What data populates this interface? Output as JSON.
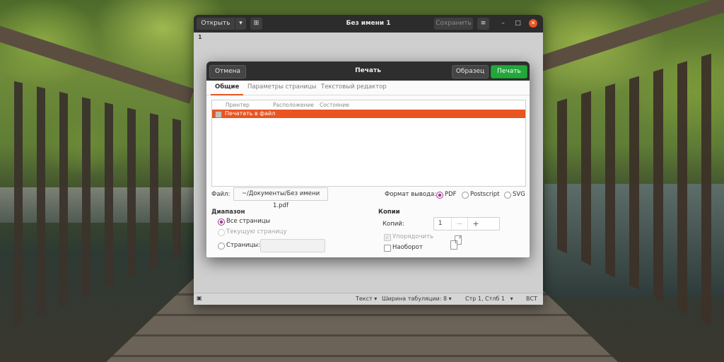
{
  "editor_window": {
    "title": "Без имени 1",
    "open_label": "Открыть",
    "save_label": "Сохранить",
    "line_number": "1",
    "status": {
      "syntax": "Текст",
      "tab_width": "Ширина табуляции: 8",
      "position": "Стр 1, Стлб 1",
      "insert_mode": "ВСТ"
    }
  },
  "print_dialog": {
    "title": "Печать",
    "cancel_label": "Отмена",
    "preview_label": "Образец",
    "print_label": "Печать",
    "tabs": [
      "Общие",
      "Параметры страницы",
      "Текстовый редактор"
    ],
    "active_tab": "Общие",
    "printer_columns": [
      "Принтер",
      "Расположение",
      "Состояние"
    ],
    "printers": [
      {
        "name": "Печатать в файл",
        "selected": true
      }
    ],
    "file_label": "Файл:",
    "file_value": "~/Документы/Без имени 1.pdf",
    "output_format_label": "Формат вывода:",
    "output_formats": [
      {
        "label": "PDF",
        "selected": true
      },
      {
        "label": "Postscript",
        "selected": false
      },
      {
        "label": "SVG",
        "selected": false
      }
    ],
    "range": {
      "heading": "Диапазон",
      "all_pages": "Все страницы",
      "current_page": "Текущую страницу",
      "pages_label": "Страницы:",
      "pages_value": ""
    },
    "copies": {
      "heading": "Копии",
      "copies_label": "Копий:",
      "copies_value": "1",
      "collate_label": "Упорядочить",
      "collate_checked": true,
      "reverse_label": "Наоборот",
      "reverse_checked": false,
      "collate_preview": [
        "1",
        "2"
      ]
    },
    "accent_color": "#e95420",
    "print_button_color": "#22a83a"
  }
}
